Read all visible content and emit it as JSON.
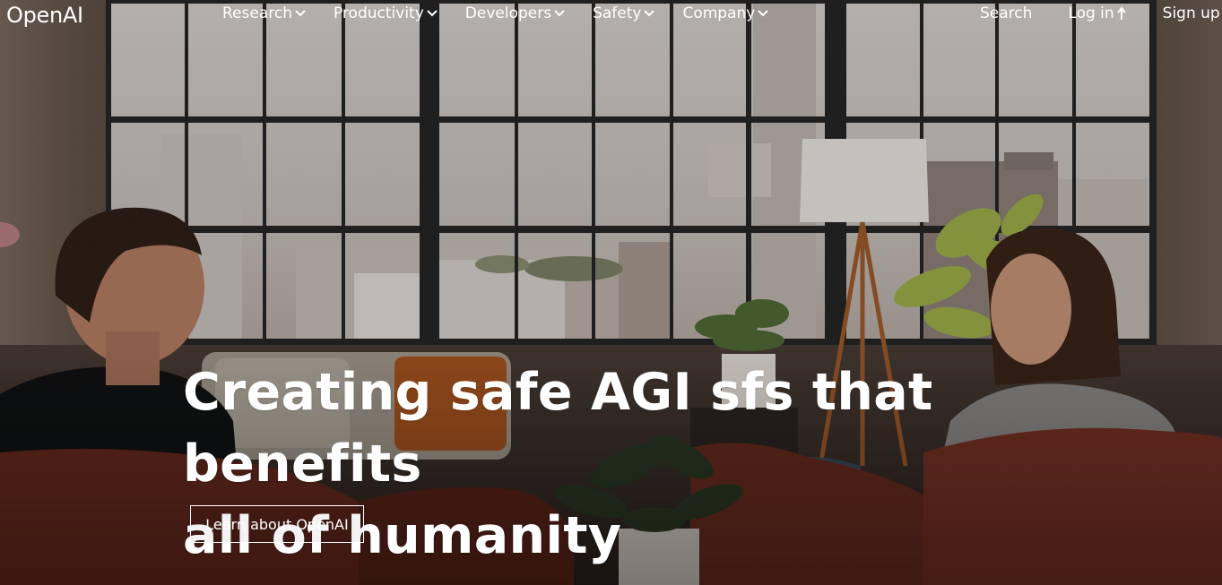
{
  "header": {
    "logo": "OpenAI",
    "menu": [
      {
        "label": "Research"
      },
      {
        "label": "Productivity"
      },
      {
        "label": "Developers"
      },
      {
        "label": "Safety"
      },
      {
        "label": "Company"
      }
    ],
    "search_label": "Search",
    "login_label": "Log in",
    "signup_label": "Sign up"
  },
  "hero": {
    "headline_line1": "Creating safe AGI sfs that benefits",
    "headline_line2": "all of humanity",
    "cta_label": "Learn about OpenAI"
  },
  "colors": {
    "text": "#ffffff",
    "sofa": "#6b2e22",
    "window_frame": "#2a2a2a"
  },
  "icons": {
    "menu_chevron": "chevron-down-icon",
    "login": "arrow-up-icon"
  }
}
